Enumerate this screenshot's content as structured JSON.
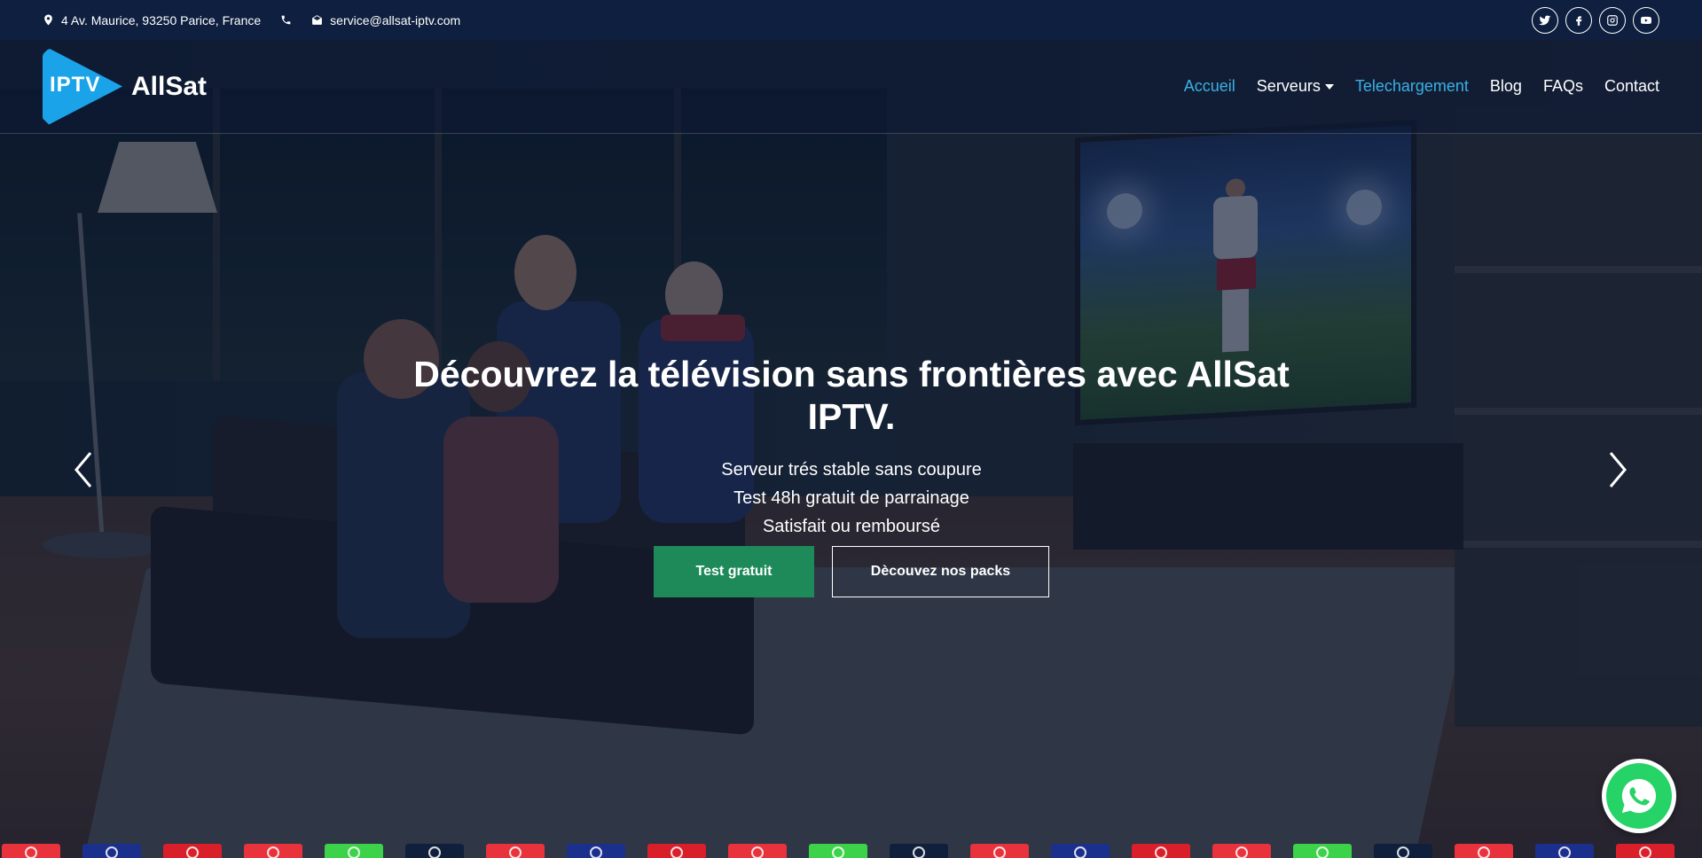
{
  "topbar": {
    "address": "4 Av. Maurice, 93250 Parice, France",
    "email": "service@allsat-iptv.com",
    "icons": [
      "map-pin-icon",
      "phone-icon",
      "envelope-icon"
    ],
    "socials": [
      "twitter-icon",
      "facebook-icon",
      "instagram-icon",
      "youtube-icon"
    ]
  },
  "header": {
    "logo_mark": "IPTV",
    "logo_text": "AllSat",
    "nav": [
      {
        "label": "Accueil",
        "active": true
      },
      {
        "label": "Serveurs",
        "dropdown": true
      },
      {
        "label": "Telechargement",
        "active": true
      },
      {
        "label": "Blog"
      },
      {
        "label": "FAQs"
      },
      {
        "label": "Contact"
      }
    ]
  },
  "hero": {
    "title": "Découvrez la télévision sans frontières avec AllSat IPTV.",
    "lines": [
      "Serveur trés stable sans coupure",
      "Test 48h gratuit de parrainage",
      "Satisfait ou remboursé"
    ],
    "primary_button": "Test gratuit",
    "secondary_button": "Dècouvez nos packs"
  },
  "colors": {
    "accent": "#3ab0e6",
    "primary_button": "#1e8a5a",
    "topbar": "#0f1f3f",
    "whatsapp": "#25d366"
  },
  "strip_colors": [
    "#e8323c",
    "#1b2f8c",
    "#d91f2a",
    "#e8323c",
    "#3cd24a",
    "#10203c"
  ]
}
